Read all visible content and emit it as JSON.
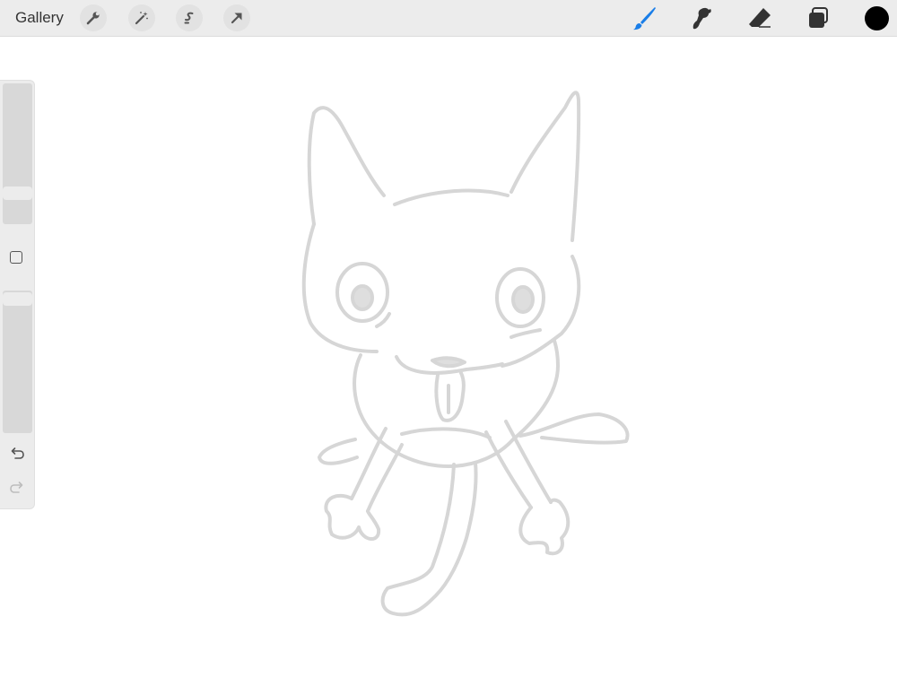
{
  "toolbar": {
    "gallery_label": "Gallery",
    "left_tools": [
      "wrench-icon",
      "magic-wand-icon",
      "selection-icon",
      "transform-arrow-icon"
    ],
    "right_tools": [
      "brush-icon",
      "smudge-icon",
      "eraser-icon",
      "layers-icon"
    ],
    "active_tool": "brush",
    "accent_color": "#1a7ee8",
    "current_color": "#000000"
  },
  "sidebar": {
    "brush_size_level": 0.2,
    "opacity_level": 0.95,
    "modify_button": "square-icon",
    "undo": "undo-icon",
    "redo": "redo-icon"
  },
  "canvas": {
    "background": "#ffffff",
    "stroke_color": "#d6d6d6"
  }
}
